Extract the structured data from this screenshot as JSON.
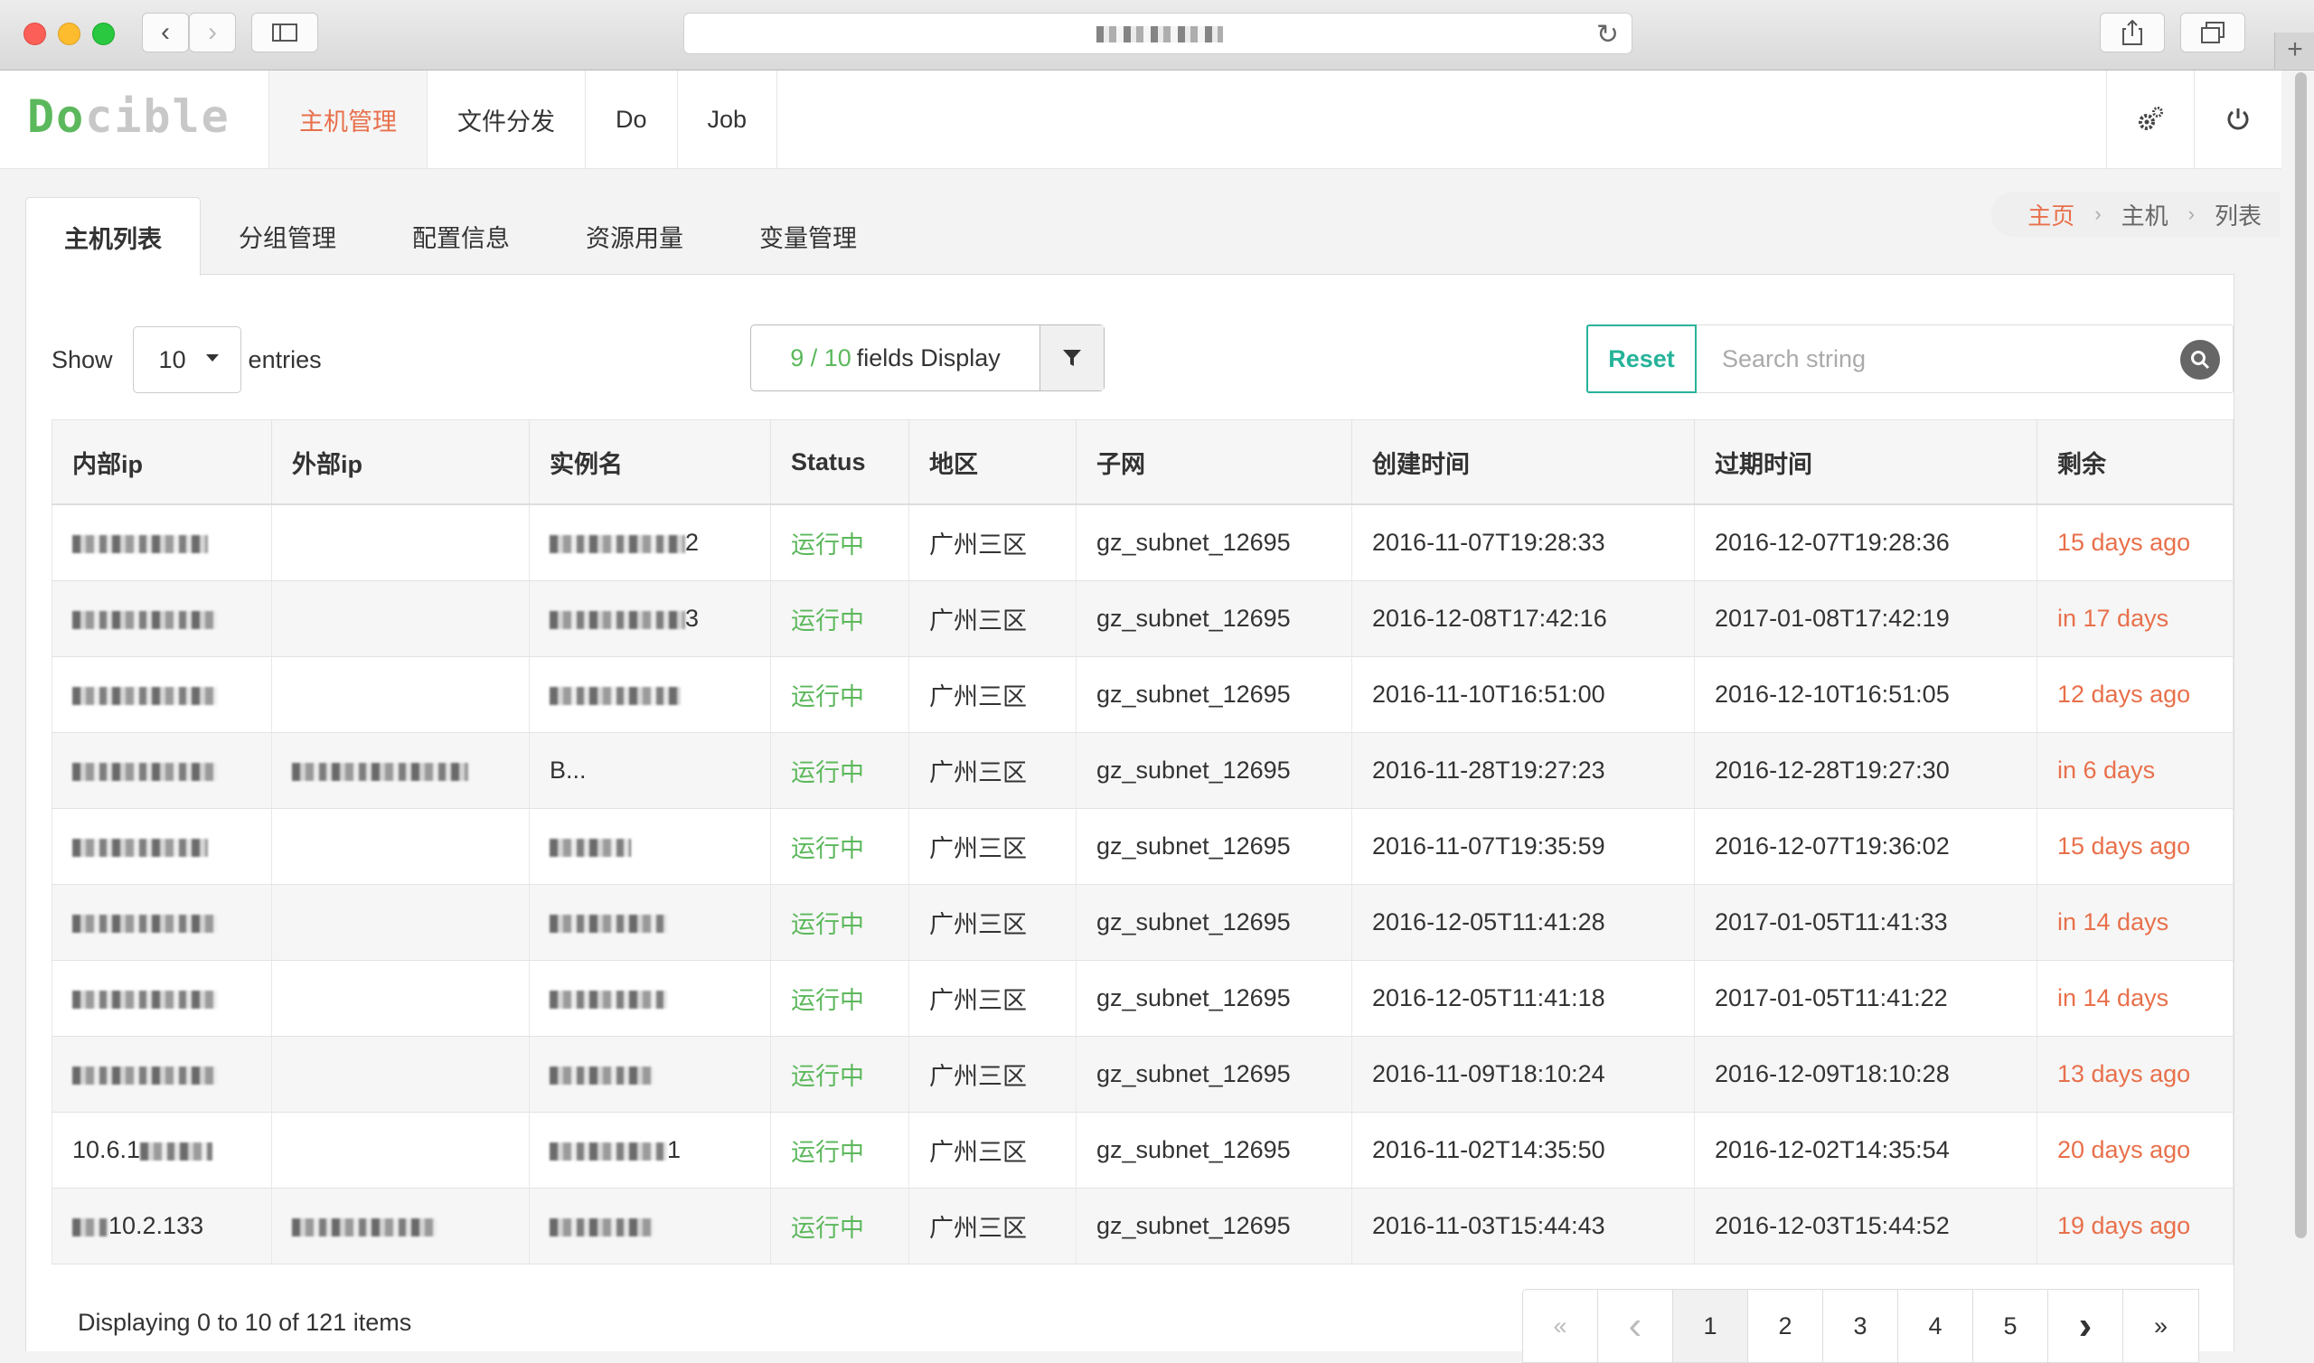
{
  "app": {
    "logo_a": "Do",
    "logo_b": "cible",
    "nav": [
      {
        "label": "主机管理",
        "active": true
      },
      {
        "label": "文件分发",
        "active": false
      },
      {
        "label": "Do",
        "active": false
      },
      {
        "label": "Job",
        "active": false
      }
    ],
    "header_icons": [
      "settings-gear-icon",
      "power-icon"
    ]
  },
  "tabs": [
    {
      "label": "主机列表",
      "active": true
    },
    {
      "label": "分组管理",
      "active": false
    },
    {
      "label": "配置信息",
      "active": false
    },
    {
      "label": "资源用量",
      "active": false
    },
    {
      "label": "变量管理",
      "active": false
    }
  ],
  "breadcrumb": {
    "home": "主页",
    "middle": "主机",
    "current": "列表"
  },
  "toolbar": {
    "show_label": "Show",
    "page_size": "10",
    "entries_label": "entries",
    "fields_count": "9 / 10",
    "fields_label": "fields Display",
    "reset_label": "Reset",
    "search_placeholder": "Search string"
  },
  "table": {
    "headers": [
      "内部ip",
      "外部ip",
      "实例名",
      "Status",
      "地区",
      "子网",
      "创建时间",
      "过期时间",
      "剩余"
    ],
    "rows": [
      {
        "internal_ip": "",
        "external_ip": "",
        "instance": "2",
        "status": "运行中",
        "region": "广州三区",
        "subnet": "gz_subnet_12695",
        "created": "2016-11-07T19:28:33",
        "expires": "2016-12-07T19:28:36",
        "remaining": "15 days ago"
      },
      {
        "internal_ip": "",
        "external_ip": "",
        "instance": "3",
        "status": "运行中",
        "region": "广州三区",
        "subnet": "gz_subnet_12695",
        "created": "2016-12-08T17:42:16",
        "expires": "2017-01-08T17:42:19",
        "remaining": "in 17 days"
      },
      {
        "internal_ip": "",
        "external_ip": "",
        "instance": "",
        "status": "运行中",
        "region": "广州三区",
        "subnet": "gz_subnet_12695",
        "created": "2016-11-10T16:51:00",
        "expires": "2016-12-10T16:51:05",
        "remaining": "12 days ago"
      },
      {
        "internal_ip": "",
        "external_ip": "",
        "instance": "B...",
        "status": "运行中",
        "region": "广州三区",
        "subnet": "gz_subnet_12695",
        "created": "2016-11-28T19:27:23",
        "expires": "2016-12-28T19:27:30",
        "remaining": "in 6 days"
      },
      {
        "internal_ip": "",
        "external_ip": "",
        "instance": "",
        "status": "运行中",
        "region": "广州三区",
        "subnet": "gz_subnet_12695",
        "created": "2016-11-07T19:35:59",
        "expires": "2016-12-07T19:36:02",
        "remaining": "15 days ago"
      },
      {
        "internal_ip": "",
        "external_ip": "",
        "instance": "",
        "status": "运行中",
        "region": "广州三区",
        "subnet": "gz_subnet_12695",
        "created": "2016-12-05T11:41:28",
        "expires": "2017-01-05T11:41:33",
        "remaining": "in 14 days"
      },
      {
        "internal_ip": "",
        "external_ip": "",
        "instance": "",
        "status": "运行中",
        "region": "广州三区",
        "subnet": "gz_subnet_12695",
        "created": "2016-12-05T11:41:18",
        "expires": "2017-01-05T11:41:22",
        "remaining": "in 14 days"
      },
      {
        "internal_ip": "",
        "external_ip": "",
        "instance": "",
        "status": "运行中",
        "region": "广州三区",
        "subnet": "gz_subnet_12695",
        "created": "2016-11-09T18:10:24",
        "expires": "2016-12-09T18:10:28",
        "remaining": "13 days ago"
      },
      {
        "internal_ip": "10.6.1",
        "external_ip": "",
        "instance": "1",
        "status": "运行中",
        "region": "广州三区",
        "subnet": "gz_subnet_12695",
        "created": "2016-11-02T14:35:50",
        "expires": "2016-12-02T14:35:54",
        "remaining": "20 days ago"
      },
      {
        "internal_ip": "10.2.133",
        "external_ip": "",
        "instance": "",
        "status": "运行中",
        "region": "广州三区",
        "subnet": "gz_subnet_12695",
        "created": "2016-11-03T15:44:43",
        "expires": "2016-12-03T15:44:52",
        "remaining": "19 days ago"
      }
    ]
  },
  "footer": {
    "displaying": "Displaying 0 to 10 of 121 items"
  },
  "pagination": {
    "first": "«",
    "prev": "‹",
    "pages": [
      "1",
      "2",
      "3",
      "4",
      "5"
    ],
    "current": "1",
    "next": "›",
    "last": "»"
  }
}
